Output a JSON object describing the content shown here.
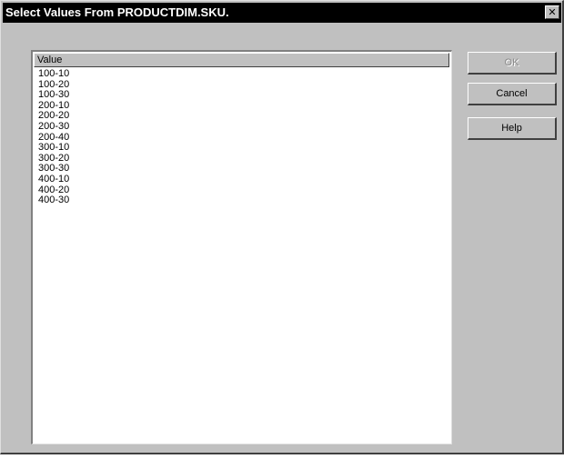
{
  "window": {
    "title": "Select Values From PRODUCTDIM.SKU.",
    "close_glyph": "✕"
  },
  "list": {
    "header": "Value",
    "items": [
      "100-10",
      "100-20",
      "100-30",
      "200-10",
      "200-20",
      "200-30",
      "200-40",
      "300-10",
      "300-20",
      "300-30",
      "400-10",
      "400-20",
      "400-30"
    ]
  },
  "buttons": {
    "ok_label": "OK",
    "cancel_label": "Cancel",
    "help_label": "Help"
  },
  "colors": {
    "dialog_face": "#c0c0c0",
    "title_bar": "#000000",
    "title_text": "#ffffff"
  }
}
